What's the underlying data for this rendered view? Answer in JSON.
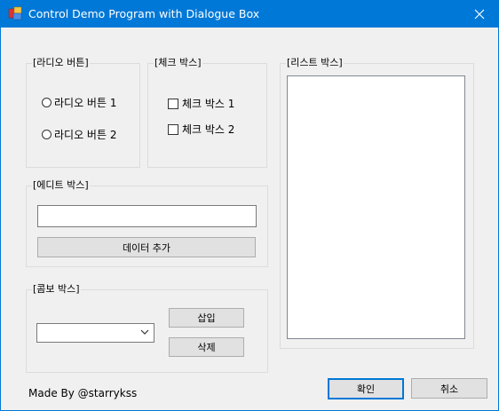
{
  "window": {
    "title": "Control Demo Program with Dialogue Box"
  },
  "radio_group": {
    "title": "[라디오 버튼]",
    "options": [
      "라디오 버튼 1",
      "라디오 버튼 2"
    ]
  },
  "check_group": {
    "title": "[체크 박스]",
    "options": [
      "체크 박스 1",
      "체크 박스 2"
    ]
  },
  "edit_group": {
    "title": "[에디트 박스]",
    "input_value": "",
    "add_button": "데이터 추가"
  },
  "combo_group": {
    "title": "[콤보 박스]",
    "selected": "",
    "insert_button": "삽입",
    "delete_button": "삭제"
  },
  "list_group": {
    "title": "[리스트 박스]",
    "items": []
  },
  "footer": {
    "credit": "Made By @starrykss",
    "ok_button": "확인",
    "cancel_button": "취소"
  },
  "colors": {
    "titlebar": "#0078d7",
    "dialog_bg": "#f0f0f0",
    "default_button_border": "#0078d7"
  }
}
